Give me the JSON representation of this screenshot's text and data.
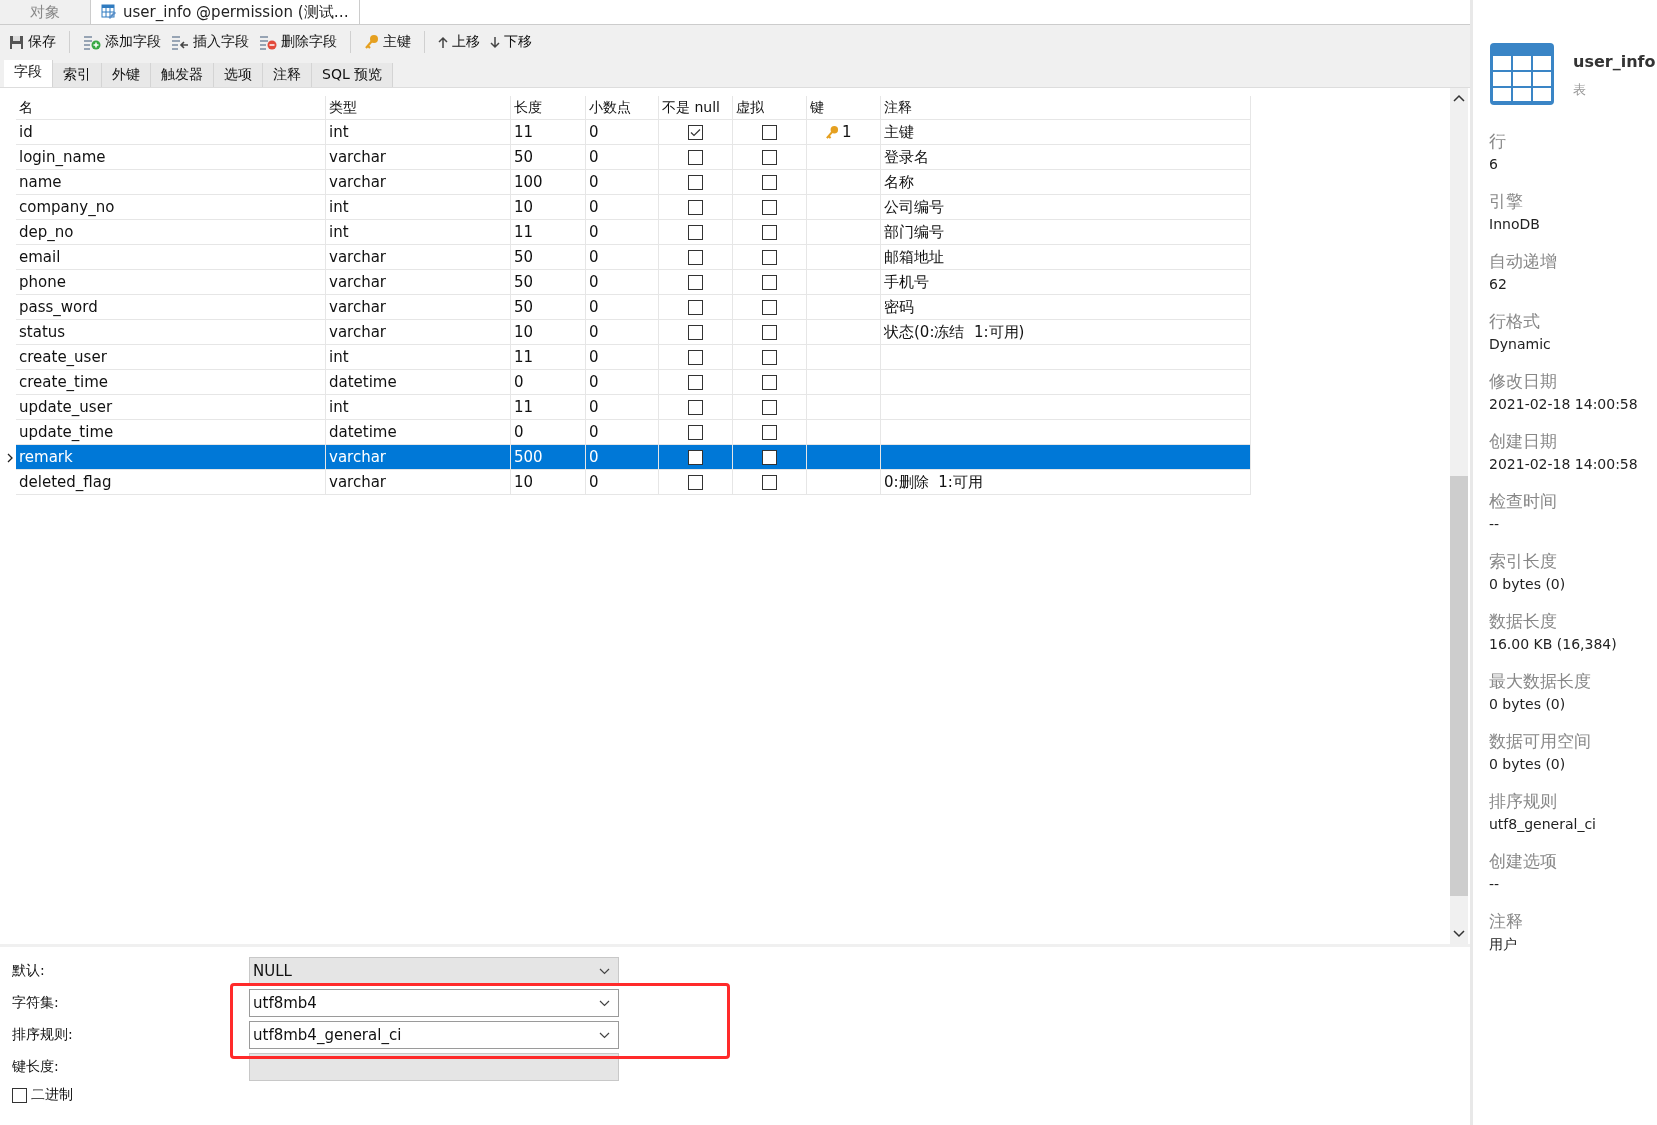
{
  "doc_tabs": [
    {
      "label": "对象",
      "selected": false,
      "kind": "plain"
    },
    {
      "label": "user_info @permission (测试…",
      "selected": true,
      "kind": "table"
    }
  ],
  "toolbar": [
    {
      "label": "保存",
      "kind": "save"
    },
    {
      "label": "添加字段",
      "kind": "add"
    },
    {
      "label": "插入字段",
      "kind": "insert"
    },
    {
      "label": "删除字段",
      "kind": "delete"
    },
    {
      "label": "主键",
      "kind": "key"
    },
    {
      "label": "上移",
      "kind": "up"
    },
    {
      "label": "下移",
      "kind": "down"
    }
  ],
  "sub_tabs": [
    {
      "label": "字段",
      "selected": true
    },
    {
      "label": "索引",
      "selected": false
    },
    {
      "label": "外键",
      "selected": false
    },
    {
      "label": "触发器",
      "selected": false
    },
    {
      "label": "选项",
      "selected": false
    },
    {
      "label": "注释",
      "selected": false
    },
    {
      "label": "SQL 预览",
      "selected": false
    }
  ],
  "table": {
    "columns": [
      "名",
      "类型",
      "长度",
      "小数点",
      "不是 null",
      "虚拟",
      "键",
      "注释"
    ],
    "rows": [
      {
        "name": "id",
        "type": "int",
        "length": "11",
        "decimals": "0",
        "not_null": true,
        "virtual": false,
        "key": "1",
        "comment": "主键",
        "selected": false
      },
      {
        "name": "login_name",
        "type": "varchar",
        "length": "50",
        "decimals": "0",
        "not_null": false,
        "virtual": false,
        "comment": "登录名",
        "selected": false
      },
      {
        "name": "name",
        "type": "varchar",
        "length": "100",
        "decimals": "0",
        "not_null": false,
        "virtual": false,
        "comment": "名称",
        "selected": false
      },
      {
        "name": "company_no",
        "type": "int",
        "length": "10",
        "decimals": "0",
        "not_null": false,
        "virtual": false,
        "comment": "公司编号",
        "selected": false
      },
      {
        "name": "dep_no",
        "type": "int",
        "length": "11",
        "decimals": "0",
        "not_null": false,
        "virtual": false,
        "comment": "部门编号",
        "selected": false
      },
      {
        "name": "email",
        "type": "varchar",
        "length": "50",
        "decimals": "0",
        "not_null": false,
        "virtual": false,
        "comment": "邮箱地址",
        "selected": false
      },
      {
        "name": "phone",
        "type": "varchar",
        "length": "50",
        "decimals": "0",
        "not_null": false,
        "virtual": false,
        "comment": "手机号",
        "selected": false
      },
      {
        "name": "pass_word",
        "type": "varchar",
        "length": "50",
        "decimals": "0",
        "not_null": false,
        "virtual": false,
        "comment": "密码",
        "selected": false
      },
      {
        "name": "status",
        "type": "varchar",
        "length": "10",
        "decimals": "0",
        "not_null": false,
        "virtual": false,
        "comment": "状态(0:冻结  1:可用)",
        "selected": false
      },
      {
        "name": "create_user",
        "type": "int",
        "length": "11",
        "decimals": "0",
        "not_null": false,
        "virtual": false,
        "selected": false
      },
      {
        "name": "create_time",
        "type": "datetime",
        "length": "0",
        "decimals": "0",
        "not_null": false,
        "virtual": false,
        "selected": false
      },
      {
        "name": "update_user",
        "type": "int",
        "length": "11",
        "decimals": "0",
        "not_null": false,
        "virtual": false,
        "selected": false
      },
      {
        "name": "update_time",
        "type": "datetime",
        "length": "0",
        "decimals": "0",
        "not_null": false,
        "virtual": false,
        "selected": false
      },
      {
        "name": "remark",
        "type": "varchar",
        "length": "500",
        "decimals": "0",
        "not_null": false,
        "virtual": false,
        "selected": true
      },
      {
        "name": "deleted_flag",
        "type": "varchar",
        "length": "10",
        "decimals": "0",
        "not_null": false,
        "virtual": false,
        "comment": "0:删除  1:可用",
        "selected": false
      }
    ]
  },
  "field_props": [
    {
      "label": "默认:",
      "value": "NULL",
      "kind": "dropdown",
      "disabled": true,
      "highlighted": false
    },
    {
      "label": "字符集:",
      "value": "utf8mb4",
      "kind": "dropdown",
      "disabled": false,
      "highlighted": true
    },
    {
      "label": "排序规则:",
      "value": "utf8mb4_general_ci",
      "kind": "dropdown",
      "disabled": false,
      "highlighted": true
    },
    {
      "label": "键长度:",
      "kind": "text",
      "disabled": true,
      "highlighted": false
    }
  ],
  "binary": {
    "label": "二进制",
    "checked": false
  },
  "info": {
    "title": "user_info",
    "subtitle": "表",
    "props": [
      {
        "label": "行",
        "value": "6"
      },
      {
        "label": "引擎",
        "value": "InnoDB"
      },
      {
        "label": "自动递增",
        "value": "62"
      },
      {
        "label": "行格式",
        "value": "Dynamic"
      },
      {
        "label": "修改日期",
        "value": "2021-02-18 14:00:58"
      },
      {
        "label": "创建日期",
        "value": "2021-02-18 14:00:58"
      },
      {
        "label": "检查时间",
        "value": "--"
      },
      {
        "label": "索引长度",
        "value": "0 bytes (0)"
      },
      {
        "label": "数据长度",
        "value": "16.00 KB (16,384)"
      },
      {
        "label": "最大数据长度",
        "value": "0 bytes (0)"
      },
      {
        "label": "数据可用空间",
        "value": "0 bytes (0)"
      },
      {
        "label": "排序规则",
        "value": "utf8_general_ci"
      },
      {
        "label": "创建选项",
        "value": "--"
      },
      {
        "label": "注释",
        "value": "用户"
      }
    ]
  }
}
